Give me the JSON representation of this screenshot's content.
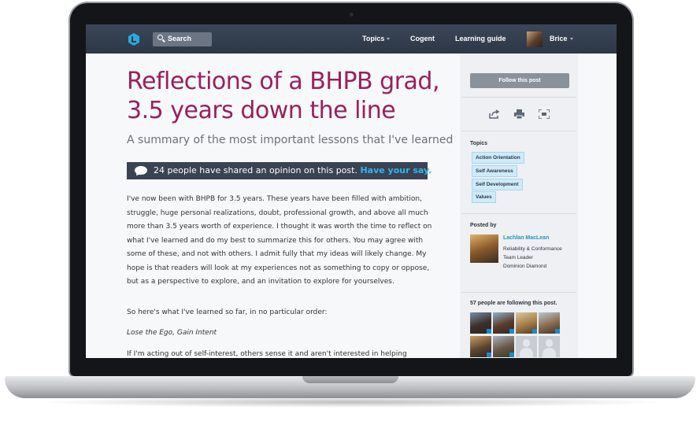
{
  "nav": {
    "search_label": "Search",
    "topics_label": "Topics",
    "cogent_label": "Cogent",
    "learning_guide_label": "Learning guide",
    "user_name": "Brice"
  },
  "article": {
    "title": "Reflections of a BHPB grad, 3.5 years down the line",
    "subtitle": "A summary of the most important lessons that I've learned",
    "share_text": "24 people have shared an opinion on this post.",
    "share_link": "Have your say.",
    "para1": "I've now been with BHPB for 3.5 years.  These years have been filled with ambition, struggle, huge personal realizations, doubt, professional growth, and above all much more than 3.5 years worth of experience.  I thought it was worth the time to reflect on what I've learned and do my best to summarize this for others.  You may agree with some of these, and not with others.  I admit fully that my ideas will likely change.  My hope is that readers will look at my experiences not as something to copy or oppose, but as a perspective to explore, and an invitation to explore for yourselves.",
    "para2": "So here's what I've learned so far, in no particular order:",
    "para3": "Lose the Ego, Gain Intent",
    "para4": "If I'm acting out of self-interest, others sense it and aren't interested in helping"
  },
  "sidebar": {
    "follow_label": "Follow this post",
    "topics_heading": "Topics",
    "topics": [
      "Action Orientation",
      "Self Awareness",
      "Self Development",
      "Values"
    ],
    "posted_by_heading": "Posted by",
    "author_name": "Lachlan MacLean",
    "author_role": "Reliability & Conformance Team Leader",
    "author_org": "Dominion Diamond",
    "followers_heading": "57 people are following this post."
  },
  "colors": {
    "title": "#9a1f5e",
    "link": "#35b4ef",
    "nav_bg": "#2d3746",
    "share_bar": "#3a4352"
  }
}
